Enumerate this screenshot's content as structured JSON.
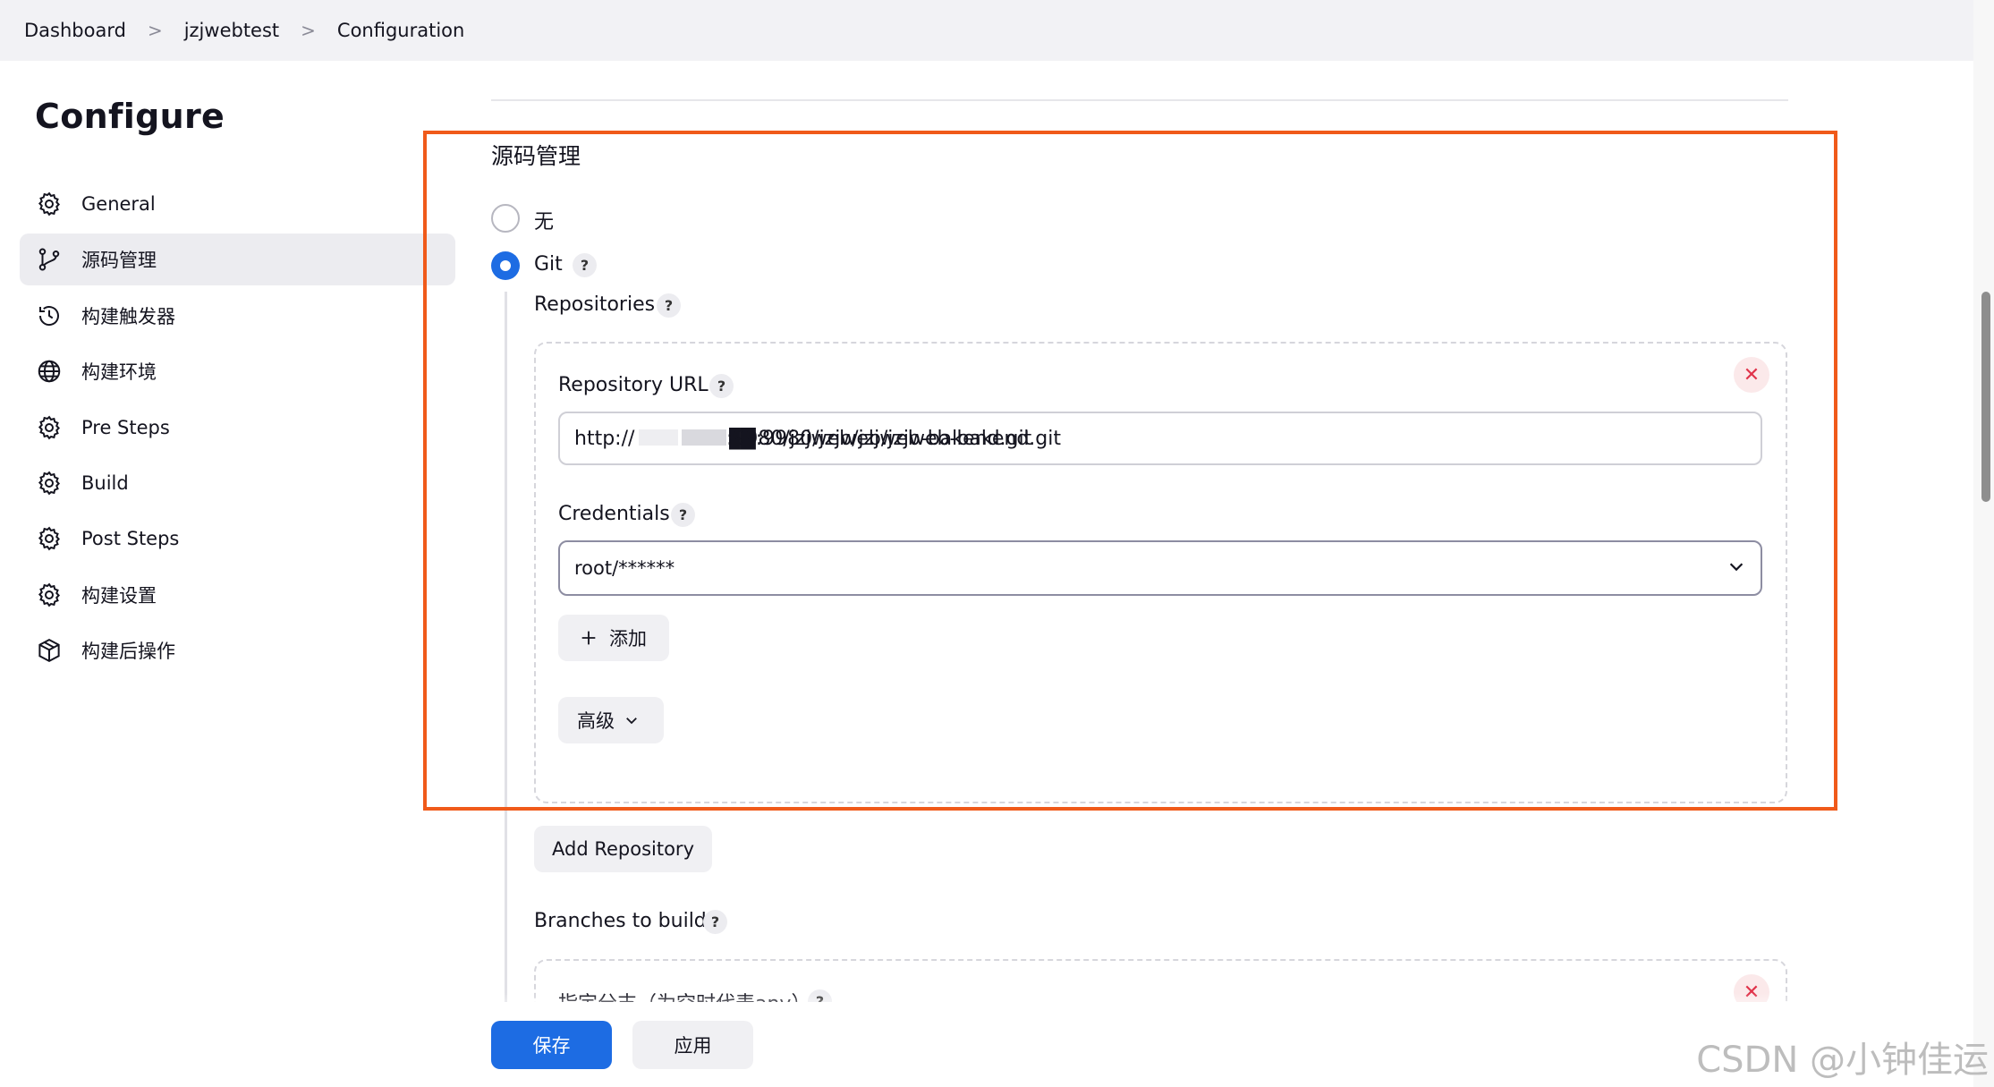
{
  "breadcrumb": {
    "items": [
      "Dashboard",
      "jzjwebtest",
      "Configuration"
    ],
    "separator": ">"
  },
  "sidebar": {
    "title": "Configure",
    "items": [
      {
        "label": "General",
        "icon": "gear-icon"
      },
      {
        "label": "源码管理",
        "icon": "git-branch-icon",
        "active": true
      },
      {
        "label": "构建触发器",
        "icon": "clock-icon"
      },
      {
        "label": "构建环境",
        "icon": "globe-icon"
      },
      {
        "label": "Pre Steps",
        "icon": "gear-icon"
      },
      {
        "label": "Build",
        "icon": "gear-icon"
      },
      {
        "label": "Post Steps",
        "icon": "gear-icon"
      },
      {
        "label": "构建设置",
        "icon": "gear-icon"
      },
      {
        "label": "构建后操作",
        "icon": "package-icon"
      }
    ]
  },
  "scm": {
    "title": "源码管理",
    "options": [
      {
        "label": "无",
        "selected": false
      },
      {
        "label": "Git",
        "selected": true
      }
    ],
    "help": "?",
    "repositories_label": "Repositories",
    "repository_url_label": "Repository URL",
    "repository_url_value": "http://████████:9980/jzjweb/jzjweb-bakend.git",
    "repository_url_visible": ":9980/jzjweb/jzjweb-bakend.git",
    "repository_url_prefix": "http://",
    "credentials_label": "Credentials",
    "credentials_value": "root/******",
    "add_label": "添加",
    "advanced_label": "高级",
    "add_repository_label": "Add Repository",
    "branches_label": "Branches to build",
    "branch_spec_label": "指定分支（为空时代表any）",
    "close_symbol": "✕"
  },
  "actions": {
    "save_label": "保存",
    "apply_label": "应用"
  },
  "watermark": "CSDN @小钟佳运",
  "colors": {
    "accent": "#1d6ce3",
    "highlight": "#f05a1a",
    "danger": "#e0334a"
  }
}
